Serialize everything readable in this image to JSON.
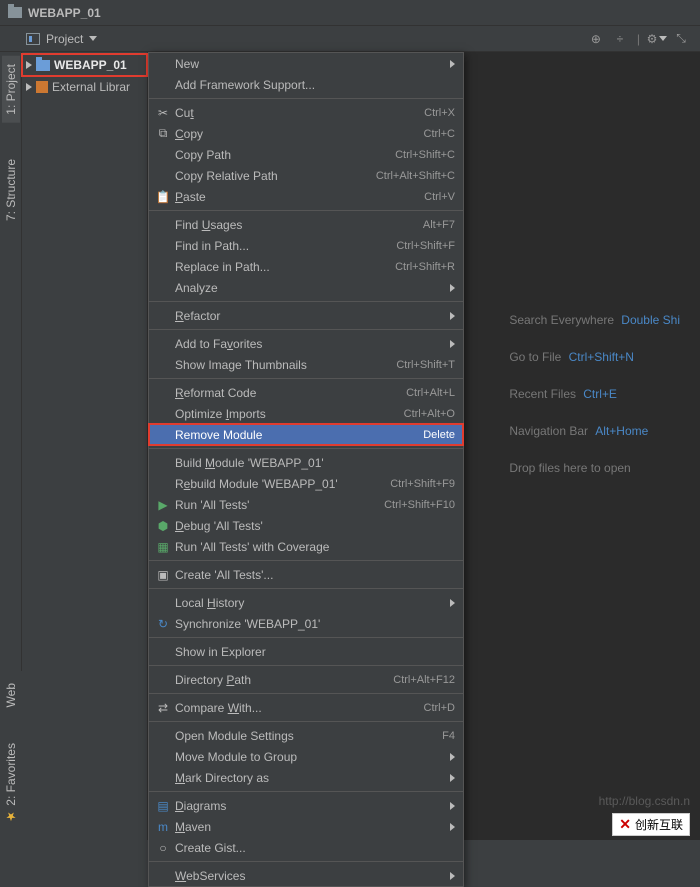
{
  "title": "WEBAPP_01",
  "toolbar": {
    "project_label": "Project"
  },
  "tree": {
    "root": "WEBAPP_01",
    "external": "External Librar"
  },
  "side_tabs": {
    "project": "1: Project",
    "structure": "7: Structure",
    "web": "Web",
    "favorites": "2: Favorites"
  },
  "hints": {
    "search_everywhere": "Search Everywhere",
    "double_shift": "Double Shi",
    "go_to_file": "Go to File",
    "go_to_file_key": "Ctrl+Shift+N",
    "recent_files": "Recent Files",
    "recent_files_key": "Ctrl+E",
    "nav_bar": "Navigation Bar",
    "nav_bar_key": "Alt+Home",
    "drop_files": "Drop files here to open"
  },
  "menu": [
    {
      "type": "item",
      "label": "New",
      "submenu": true
    },
    {
      "type": "item",
      "label": "Add Framework Support..."
    },
    {
      "type": "sep"
    },
    {
      "type": "item",
      "icon": "scissors-icon",
      "label": "Cut",
      "underline": 2,
      "shortcut": "Ctrl+X"
    },
    {
      "type": "item",
      "icon": "copy-icon",
      "label": "Copy",
      "underline": 0,
      "shortcut": "Ctrl+C"
    },
    {
      "type": "item",
      "label": "Copy Path",
      "shortcut": "Ctrl+Shift+C"
    },
    {
      "type": "item",
      "label": "Copy Relative Path",
      "shortcut": "Ctrl+Alt+Shift+C"
    },
    {
      "type": "item",
      "icon": "paste-icon",
      "label": "Paste",
      "underline": 0,
      "shortcut": "Ctrl+V"
    },
    {
      "type": "sep"
    },
    {
      "type": "item",
      "label": "Find Usages",
      "underline": 5,
      "shortcut": "Alt+F7"
    },
    {
      "type": "item",
      "label": "Find in Path...",
      "shortcut": "Ctrl+Shift+F"
    },
    {
      "type": "item",
      "label": "Replace in Path...",
      "shortcut": "Ctrl+Shift+R"
    },
    {
      "type": "item",
      "label": "Analyze",
      "submenu": true
    },
    {
      "type": "sep"
    },
    {
      "type": "item",
      "label": "Refactor",
      "underline": 0,
      "submenu": true
    },
    {
      "type": "sep"
    },
    {
      "type": "item",
      "label": "Add to Favorites",
      "underline": 9,
      "submenu": true
    },
    {
      "type": "item",
      "label": "Show Image Thumbnails",
      "shortcut": "Ctrl+Shift+T"
    },
    {
      "type": "sep"
    },
    {
      "type": "item",
      "label": "Reformat Code",
      "underline": 0,
      "shortcut": "Ctrl+Alt+L"
    },
    {
      "type": "item",
      "label": "Optimize Imports",
      "underline": 9,
      "shortcut": "Ctrl+Alt+O"
    },
    {
      "type": "item",
      "label": "Remove Module",
      "shortcut": "Delete",
      "highlighted": true
    },
    {
      "type": "sep"
    },
    {
      "type": "item",
      "label": "Build Module 'WEBAPP_01'",
      "underline": 6
    },
    {
      "type": "item",
      "label": "Rebuild Module 'WEBAPP_01'",
      "underline": 1,
      "shortcut": "Ctrl+Shift+F9"
    },
    {
      "type": "item",
      "icon": "play-icon",
      "label": "Run 'All Tests'",
      "shortcut": "Ctrl+Shift+F10"
    },
    {
      "type": "item",
      "icon": "debug-icon",
      "label": "Debug 'All Tests'",
      "underline": 0
    },
    {
      "type": "item",
      "icon": "coverage-icon",
      "label": "Run 'All Tests' with Coverage"
    },
    {
      "type": "sep"
    },
    {
      "type": "item",
      "icon": "create-icon",
      "label": "Create 'All Tests'..."
    },
    {
      "type": "sep"
    },
    {
      "type": "item",
      "label": "Local History",
      "underline": 6,
      "submenu": true
    },
    {
      "type": "item",
      "icon": "sync-icon",
      "label": "Synchronize 'WEBAPP_01'"
    },
    {
      "type": "sep"
    },
    {
      "type": "item",
      "label": "Show in Explorer"
    },
    {
      "type": "sep"
    },
    {
      "type": "item",
      "label": "Directory Path",
      "underline": 10,
      "shortcut": "Ctrl+Alt+F12"
    },
    {
      "type": "sep"
    },
    {
      "type": "item",
      "icon": "compare-icon",
      "label": "Compare With...",
      "underline": 8,
      "shortcut": "Ctrl+D"
    },
    {
      "type": "sep"
    },
    {
      "type": "item",
      "label": "Open Module Settings",
      "shortcut": "F4"
    },
    {
      "type": "item",
      "label": "Move Module to Group",
      "submenu": true
    },
    {
      "type": "item",
      "label": "Mark Directory as",
      "underline": 0,
      "submenu": true
    },
    {
      "type": "sep"
    },
    {
      "type": "item",
      "icon": "diagram-icon",
      "label": "Diagrams",
      "underline": 0,
      "submenu": true
    },
    {
      "type": "item",
      "icon": "maven-icon",
      "label": "Maven",
      "underline": 0,
      "submenu": true
    },
    {
      "type": "item",
      "icon": "gist-icon",
      "label": "Create Gist..."
    },
    {
      "type": "sep"
    },
    {
      "type": "item",
      "label": "WebServices",
      "underline": 0,
      "submenu": true
    }
  ],
  "watermark_url": "http://blog.csdn.n",
  "logo_text": "创新互联"
}
